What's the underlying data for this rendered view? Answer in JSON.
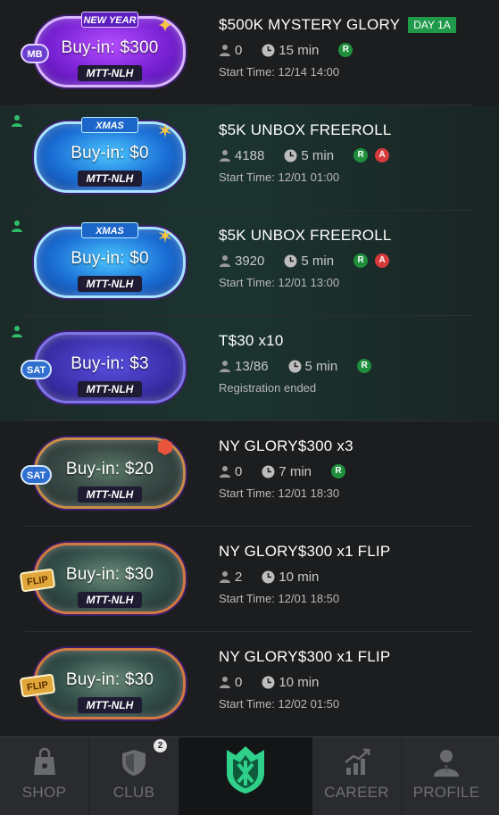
{
  "tournaments": [
    {
      "title": "$500K MYSTERY GLORY",
      "day_badge": "DAY 1A",
      "joined": false,
      "ticket": {
        "buyin": "Buy-in: $300",
        "type": "MTT-NLH",
        "banner": "NEW YEAR",
        "tag": "MB",
        "style": "purple"
      },
      "players": "0",
      "duration": "15 min",
      "badges": [
        "R"
      ],
      "status": "Start Time: 12/14 14:00"
    },
    {
      "title": "$5K UNBOX FREEROLL",
      "day_badge": "",
      "joined": true,
      "ticket": {
        "buyin": "Buy-in: $0",
        "type": "MTT-NLH",
        "banner": "XMAS",
        "tag": "",
        "style": "blue"
      },
      "players": "4188",
      "duration": "5 min",
      "badges": [
        "R",
        "A"
      ],
      "status": "Start Time: 12/01 01:00"
    },
    {
      "title": "$5K UNBOX FREEROLL",
      "day_badge": "",
      "joined": true,
      "ticket": {
        "buyin": "Buy-in: $0",
        "type": "MTT-NLH",
        "banner": "XMAS",
        "tag": "",
        "style": "blue"
      },
      "players": "3920",
      "duration": "5 min",
      "badges": [
        "R",
        "A"
      ],
      "status": "Start Time: 12/01 13:00"
    },
    {
      "title": "T$30 x10",
      "day_badge": "",
      "joined": true,
      "ticket": {
        "buyin": "Buy-in: $3",
        "type": "MTT-NLH",
        "banner": "",
        "tag": "SAT",
        "style": "indigo"
      },
      "players": "13/86",
      "duration": "5 min",
      "badges": [
        "R"
      ],
      "status": "Registration ended"
    },
    {
      "title": "NY GLORY$300 x3",
      "day_badge": "",
      "joined": false,
      "ticket": {
        "buyin": "Buy-in: $20",
        "type": "MTT-NLH",
        "banner": "",
        "tag": "SAT",
        "style": "multi"
      },
      "players": "0",
      "duration": "7 min",
      "badges": [
        "R"
      ],
      "status": "Start Time: 12/01 18:30"
    },
    {
      "title": "NY GLORY$300 x1 FLIP",
      "day_badge": "",
      "joined": false,
      "ticket": {
        "buyin": "Buy-in: $30",
        "type": "MTT-NLH",
        "banner": "",
        "tag": "FLIP",
        "style": "fire"
      },
      "players": "2",
      "duration": "10 min",
      "badges": [],
      "status": "Start Time: 12/01 18:50"
    },
    {
      "title": "NY GLORY$300 x1 FLIP",
      "day_badge": "",
      "joined": false,
      "ticket": {
        "buyin": "Buy-in: $30",
        "type": "MTT-NLH",
        "banner": "",
        "tag": "FLIP",
        "style": "fire"
      },
      "players": "0",
      "duration": "10 min",
      "badges": [],
      "status": "Start Time: 12/02 01:50"
    }
  ],
  "bottom_nav": {
    "shop": "SHOP",
    "club": "CLUB",
    "club_badge": "2",
    "career": "CAREER",
    "profile": "PROFILE"
  },
  "colors": {
    "badge_r": "#1f8f3c",
    "badge_a": "#d63a3a",
    "day_badge": "#1f9a4a",
    "brand_green": "#2fd08a"
  }
}
